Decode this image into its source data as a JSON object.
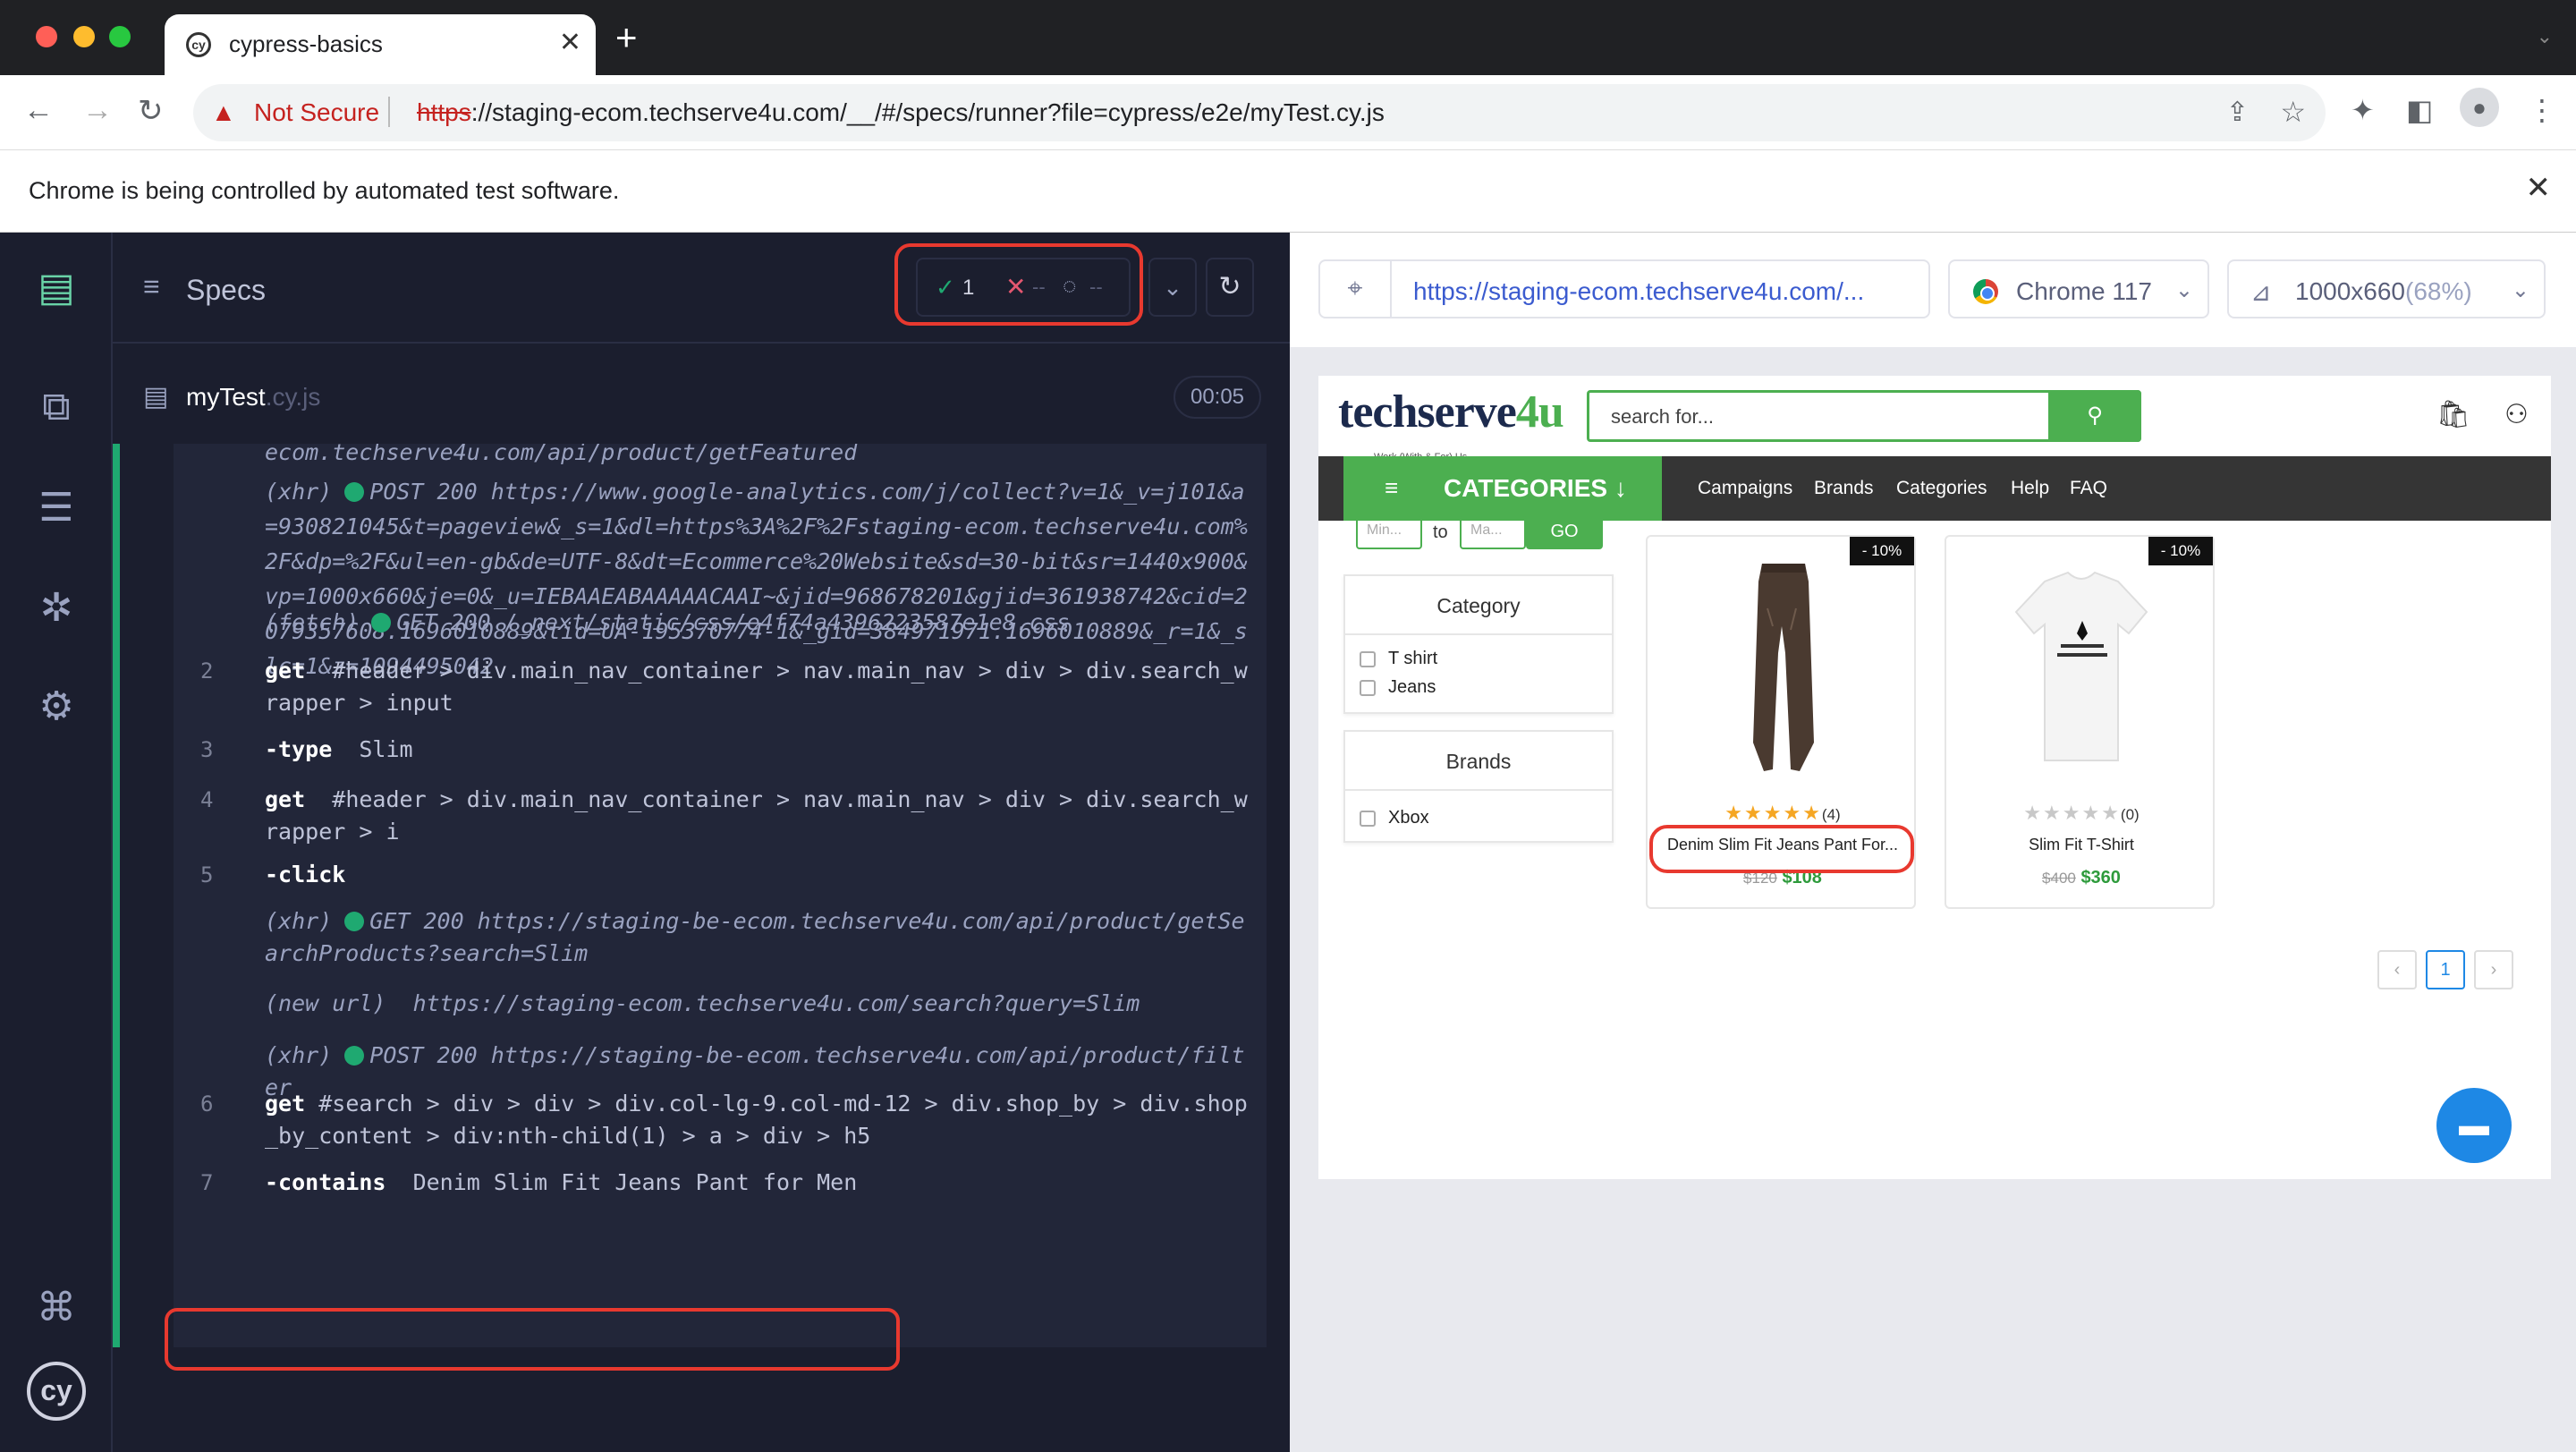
{
  "browser": {
    "tab_title": "cypress-basics",
    "not_secure_label": "Not Secure",
    "url_scheme": "https",
    "url_rest": "://staging-ecom.techserve4u.com/__/#/specs/runner?file=cypress/e2e/myTest.cy.js",
    "infobar_message": "Chrome is being controlled by automated test software."
  },
  "reporter": {
    "specs_label": "Specs",
    "stats": {
      "passed": "1",
      "failed": "--",
      "pending": "--"
    },
    "spec_name": "myTest",
    "spec_ext": ".cy.js",
    "duration": "00:05",
    "commands": [
      {
        "num": "",
        "type": "event",
        "text": "ecom.techserve4u.com/api/product/getFeatured"
      },
      {
        "num": "",
        "type": "event",
        "prefix": "(xhr)",
        "text": "POST 200 https://www.google-analytics.com/j/collect?v=1&_v=j101&a=930821045&t=pageview&_s=1&dl=https%3A%2F%2Fstaging-ecom.techserve4u.com%2F&dp=%2F&ul=en-gb&de=UTF-8&dt=Ecommerce%20Website&sd=30-bit&sr=1440x900&vp=1000x660&je=0&_u=IEBAAEABAAAAACAAI~&jid=968678201&gjid=361938742&cid=2079357608.1696010889&tid=UA-195370774-1&_gid=384971971.1696010889&_r=1&_slc=1&z=1094495042"
      },
      {
        "num": "",
        "type": "event",
        "prefix": "(fetch)",
        "text": "GET 200 /_next/static/css/e4f74a4396223587e1e8.css"
      },
      {
        "num": "2",
        "type": "cmd",
        "kw": "get",
        "text": "#header > div.main_nav_container > nav.main_nav > div > div.search_wrapper > input"
      },
      {
        "num": "3",
        "type": "cmd",
        "kw": "-type",
        "text": "Slim"
      },
      {
        "num": "4",
        "type": "cmd",
        "kw": "get",
        "text": "#header > div.main_nav_container > nav.main_nav > div > div.search_wrapper > i"
      },
      {
        "num": "5",
        "type": "cmd",
        "kw": "-click",
        "text": ""
      },
      {
        "num": "",
        "type": "event",
        "prefix": "(xhr)",
        "text": "GET 200 https://staging-be-ecom.techserve4u.com/api/product/getSearchProducts?search=Slim"
      },
      {
        "num": "",
        "type": "event",
        "prefix": "(new url)",
        "text": "https://staging-ecom.techserve4u.com/search?query=Slim"
      },
      {
        "num": "",
        "type": "event",
        "prefix": "(xhr)",
        "text": "POST 200 https://staging-be-ecom.techserve4u.com/api/product/filter"
      },
      {
        "num": "6",
        "type": "cmd",
        "kw": "get",
        "text": "#search > div > div > div.col-lg-9.col-md-12 > div.shop_by > div.shop_by_content > div:nth-child(1) > a > div > h5"
      },
      {
        "num": "7",
        "type": "cmd",
        "kw": "-contains",
        "text": "Denim Slim Fit Jeans Pant for Men"
      }
    ]
  },
  "aut": {
    "url": "https://staging-ecom.techserve4u.com/...",
    "browser": "Chrome 117",
    "viewport": "1000x660",
    "viewport_scale": "(68%)"
  },
  "site": {
    "brand_main": "techserve",
    "brand_accent": "4u",
    "brand_tagline": "Work (With & For) Us",
    "search_placeholder": "search for...",
    "categories_label": "CATEGORIES",
    "nav_links": [
      "Campaigns",
      "Brands",
      "Categories",
      "Help",
      "FAQ"
    ],
    "price_min_placeholder": "Min...",
    "price_to": "to",
    "price_max_placeholder": "Ma...",
    "go_label": "GO",
    "category_filter": {
      "title": "Category",
      "options": [
        "T shirt",
        "Jeans"
      ]
    },
    "brand_filter": {
      "title": "Brands",
      "options": [
        "Xbox"
      ]
    },
    "products": [
      {
        "name": "Denim Slim Fit Jeans Pant For...",
        "badge": "- 10%",
        "rating": 5,
        "reviews": "(4)",
        "old_price": "$120",
        "price": "$108"
      },
      {
        "name": "Slim Fit T-Shirt",
        "badge": "- 10%",
        "rating": 0,
        "reviews": "(0)",
        "old_price": "$400",
        "price": "$360"
      }
    ],
    "current_page": "1"
  },
  "colors": {
    "pass": "#1fa971",
    "fail": "#e45770",
    "brand_green": "#4caf50",
    "highlight_red": "#e8392f"
  }
}
